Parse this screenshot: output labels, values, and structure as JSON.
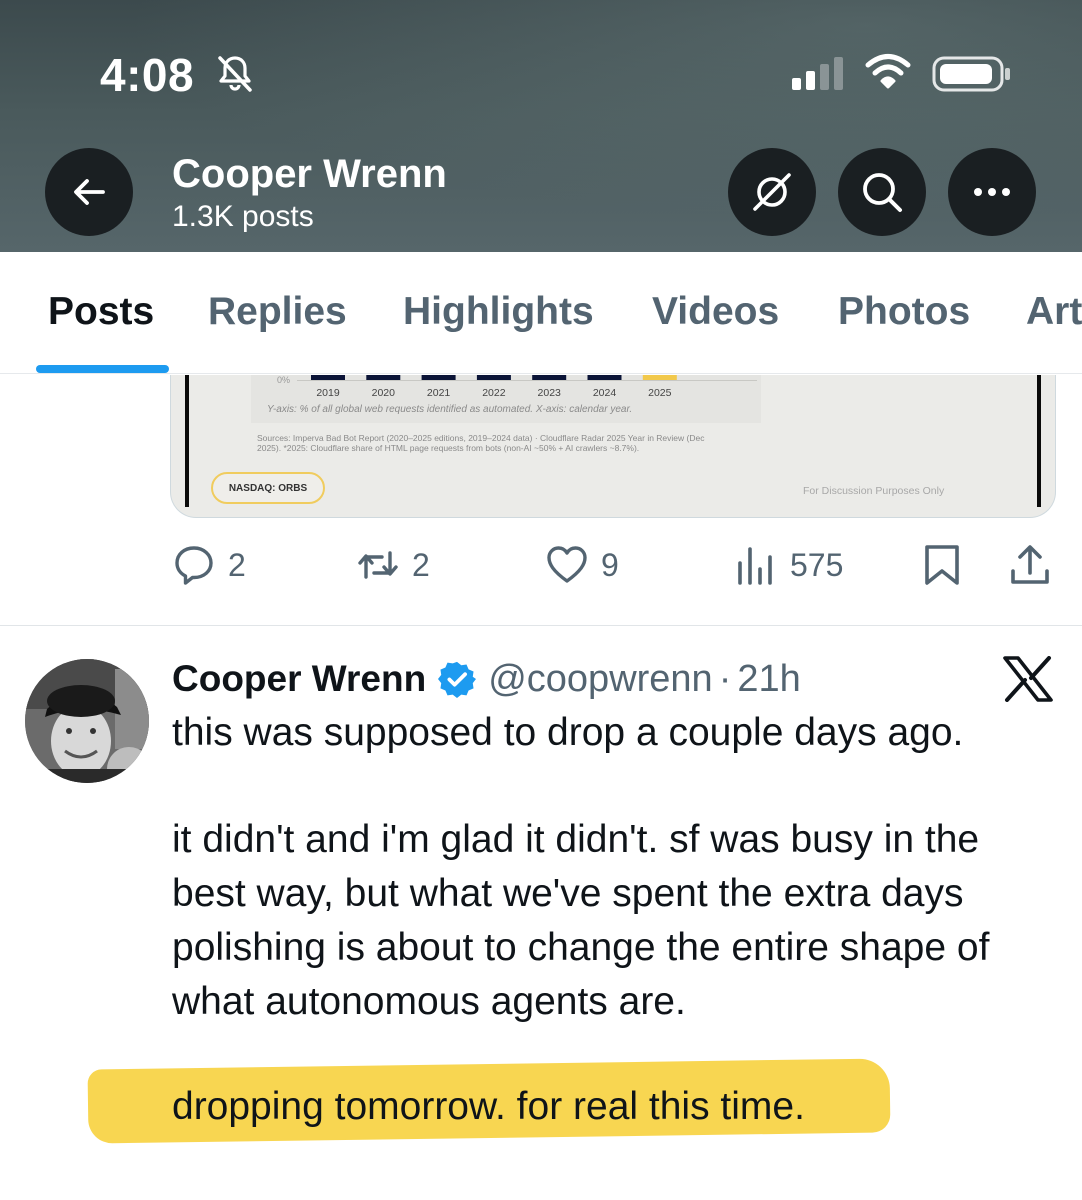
{
  "status_bar": {
    "time": "4:08"
  },
  "profile_header": {
    "name": "Cooper Wrenn",
    "posts_count": "1.3K posts"
  },
  "tabs": [
    {
      "label": "Posts",
      "active": true
    },
    {
      "label": "Replies"
    },
    {
      "label": "Highlights"
    },
    {
      "label": "Videos"
    },
    {
      "label": "Photos"
    },
    {
      "label": "Art"
    }
  ],
  "embedded_chart": {
    "y_tick": "0%",
    "years": [
      "2019",
      "2020",
      "2021",
      "2022",
      "2023",
      "2024",
      "2025"
    ],
    "axis_note": "Y-axis: % of all global web requests identified as automated. X-axis: calendar year.",
    "sources_line1": "Sources: Imperva Bad Bot Report (2020–2025 editions, 2019–2024 data) · Cloudflare Radar 2025 Year in Review (Dec",
    "sources_line2": "2025). *2025: Cloudflare share of HTML page requests from bots (non-AI ~50% + AI crawlers ~8.7%).",
    "badge": "NASDAQ: ORBS",
    "disclaimer": "For Discussion Purposes Only",
    "colors": {
      "bar": "#0b1437",
      "highlight_bar": "#f2c94c"
    }
  },
  "actions": {
    "replies": "2",
    "reposts": "2",
    "likes": "9",
    "views": "575"
  },
  "tweet": {
    "author": "Cooper Wrenn",
    "handle": "@coopwrenn",
    "separator": "·",
    "time": "21h",
    "line1": "this was supposed to drop a couple days ago.",
    "para2_line1": "it didn't and i'm glad it didn't. sf was busy in the",
    "para2_line2": "best way, but what we've spent the extra days",
    "para2_line3": "polishing is about to change the entire shape of",
    "para2_line4": "what autonomous agents are.",
    "highlighted_line": "dropping tomorrow. for real this time."
  },
  "colors": {
    "accent": "#1d9bf0",
    "highlighter": "#f7d23e"
  }
}
